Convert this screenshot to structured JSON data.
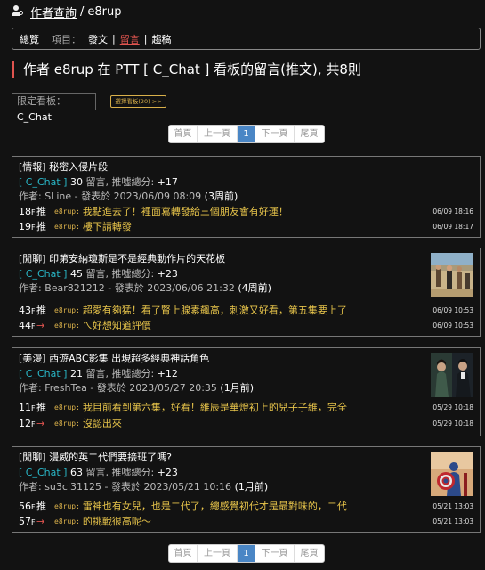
{
  "breadcrumb": {
    "section": "作者查詢",
    "separator": "/",
    "author": "e8rup"
  },
  "nav": {
    "overview": "總覽",
    "label": "項目：",
    "items": [
      "發文",
      "留言",
      "趨稿"
    ],
    "active_index": 1
  },
  "heading": "作者 e8rup 在 PTT [ C_Chat ] 看板的留言(推文), 共8則",
  "filter": {
    "label": "限定看板：",
    "value": "C_Chat",
    "button": "選擇看板(20) >>"
  },
  "pager": {
    "first": "首頁",
    "prev": "上一頁",
    "current": "1",
    "next": "下一頁",
    "last": "尾頁"
  },
  "posts": [
    {
      "title": "[情報] 秘密入侵片段",
      "board": "[ C_Chat ]",
      "count": "30",
      "count_label": "留言, 推噓總分:",
      "score": "+17",
      "author_line": "作者: SLine - 發表於 2023/06/09 08:09",
      "age": "(3周前)",
      "thumbnail": "none",
      "pushes": [
        {
          "floor": "18",
          "floor_unit": "F",
          "tag": "推",
          "user": "e8rup:",
          "msg": "我點進去了！裡面寫轉發給三個朋友會有好運！",
          "time": "06/09 18:16"
        },
        {
          "floor": "19",
          "floor_unit": "F",
          "tag": "推",
          "user": "e8rup:",
          "msg": "樓下請轉發",
          "time": "06/09 18:17"
        }
      ]
    },
    {
      "title": "[閒聊] 印第安納瓊斯是不是經典動作片的天花板",
      "board": "[ C_Chat ]",
      "count": "45",
      "count_label": "留言, 推噓總分:",
      "score": "+23",
      "author_line": "作者: Bear821212 - 發表於 2023/06/06 21:32",
      "age": "(4周前)",
      "thumbnail": "desert-scene",
      "pushes": [
        {
          "floor": "43",
          "floor_unit": "F",
          "tag": "推",
          "user": "e8rup:",
          "msg": "超愛有夠猛！看了腎上腺素飆高，刺激又好看，第五集要上了",
          "time": "06/09 10:53"
        },
        {
          "floor": "44",
          "floor_unit": "F",
          "tag": "→",
          "user": "e8rup:",
          "msg": "ㄟ好想知道評價",
          "time": "06/09 10:53"
        }
      ]
    },
    {
      "title": "[美漫] 西遊ABC影集 出現超多經典神話角色",
      "board": "[ C_Chat ]",
      "count": "21",
      "count_label": "留言, 推噓總分:",
      "score": "+12",
      "author_line": "作者: FreshTea - 發表於 2023/05/27 20:35",
      "age": "(1月前)",
      "thumbnail": "two-characters",
      "pushes": [
        {
          "floor": "11",
          "floor_unit": "F",
          "tag": "推",
          "user": "e8rup:",
          "msg": "我目前看到第六集，好看！維辰是華燈初上的兒子子維，完全",
          "time": "05/29 10:18"
        },
        {
          "floor": "12",
          "floor_unit": "F",
          "tag": "→",
          "user": "e8rup:",
          "msg": "沒認出來",
          "time": "05/29 10:18"
        }
      ]
    },
    {
      "title": "[閒聊] 漫威的英二代們要接班了嗎?",
      "board": "[ C_Chat ]",
      "count": "63",
      "count_label": "留言, 推噓總分:",
      "score": "+23",
      "author_line": "作者: su3cl31125 - 發表於 2023/05/21 10:16",
      "age": "(1月前)",
      "thumbnail": "captain-shield",
      "pushes": [
        {
          "floor": "56",
          "floor_unit": "F",
          "tag": "推",
          "user": "e8rup:",
          "msg": "雷神也有女兒，也是二代了，總感覺初代才是最對味的，二代",
          "time": "05/21 13:03"
        },
        {
          "floor": "57",
          "floor_unit": "F",
          "tag": "→",
          "user": "e8rup:",
          "msg": "的挑戰很高呢～",
          "time": "05/21 13:03"
        }
      ]
    }
  ],
  "colors": {
    "accent": "#e0544f",
    "board": "#29b6c6",
    "push_text": "#e6c34a",
    "pager_active": "#4a86c5"
  }
}
